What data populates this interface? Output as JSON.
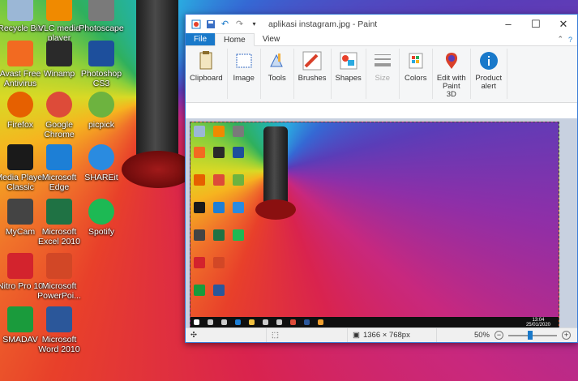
{
  "desktop": {
    "icons": [
      {
        "label": "Recycle Bin",
        "color": "#9bb7d6",
        "icon": "recycle-bin-icon"
      },
      {
        "label": "VLC media player",
        "color": "#f08a00",
        "icon": "vlc-icon"
      },
      {
        "label": "Photoscape",
        "color": "#7a7a7a",
        "icon": "photoscape-icon"
      },
      {
        "label": "Avast Free Antivirus",
        "color": "#f26a21",
        "icon": "avast-icon"
      },
      {
        "label": "Winamp",
        "color": "#2a2a2a",
        "icon": "winamp-icon"
      },
      {
        "label": "Photoshop CS3",
        "color": "#1d4f9c",
        "icon": "photoshop-icon"
      },
      {
        "label": "Firefox",
        "color": "#e66000",
        "icon": "firefox-icon"
      },
      {
        "label": "Google Chrome",
        "color": "#dd4b39",
        "icon": "chrome-icon"
      },
      {
        "label": "picpick",
        "color": "#6db33f",
        "icon": "picpick-icon"
      },
      {
        "label": "Media Player Classic",
        "color": "#1a1a1a",
        "icon": "media-player-classic-icon"
      },
      {
        "label": "Microsoft Edge",
        "color": "#1d7fd6",
        "icon": "edge-icon"
      },
      {
        "label": "SHAREit",
        "color": "#2a8be0",
        "icon": "shareit-icon"
      },
      {
        "label": "MyCam",
        "color": "#444444",
        "icon": "mycam-icon"
      },
      {
        "label": "Microsoft Excel 2010",
        "color": "#1f7244",
        "icon": "excel-icon"
      },
      {
        "label": "Spotify",
        "color": "#1db954",
        "icon": "spotify-icon"
      },
      {
        "label": "Nitro Pro 10",
        "color": "#d3232d",
        "icon": "nitro-icon"
      },
      {
        "label": "Microsoft PowerPoi...",
        "color": "#d24726",
        "icon": "powerpoint-icon"
      },
      {
        "label": "SMADAV",
        "color": "#1a9b3c",
        "icon": "smadav-icon"
      },
      {
        "label": "Microsoft Word 2010",
        "color": "#2b579a",
        "icon": "word-icon"
      }
    ]
  },
  "paint": {
    "title": "aplikasi instagram.jpg - Paint",
    "menu": {
      "file": "File",
      "home": "Home",
      "view": "View"
    },
    "ribbon": [
      {
        "label": "Clipboard",
        "icon": "clipboard-icon"
      },
      {
        "label": "Image",
        "icon": "image-icon"
      },
      {
        "label": "Tools",
        "icon": "tools-icon"
      },
      {
        "label": "Brushes",
        "icon": "brushes-icon"
      },
      {
        "label": "Shapes",
        "icon": "shapes-icon"
      },
      {
        "label": "Size",
        "icon": "size-icon"
      },
      {
        "label": "Colors",
        "icon": "colors-icon"
      },
      {
        "label": "Edit with Paint 3D",
        "icon": "paint3d-icon"
      },
      {
        "label": "Product alert",
        "icon": "product-alert-icon"
      }
    ],
    "status": {
      "dimensions": "1366 × 768px",
      "zoom": "50%"
    },
    "zoom_level": 0.5,
    "taskbar_clock": "13:04\n25/01/2020"
  },
  "colors": {
    "accent": "#1979ca",
    "window_border": "#3b7dd8"
  }
}
